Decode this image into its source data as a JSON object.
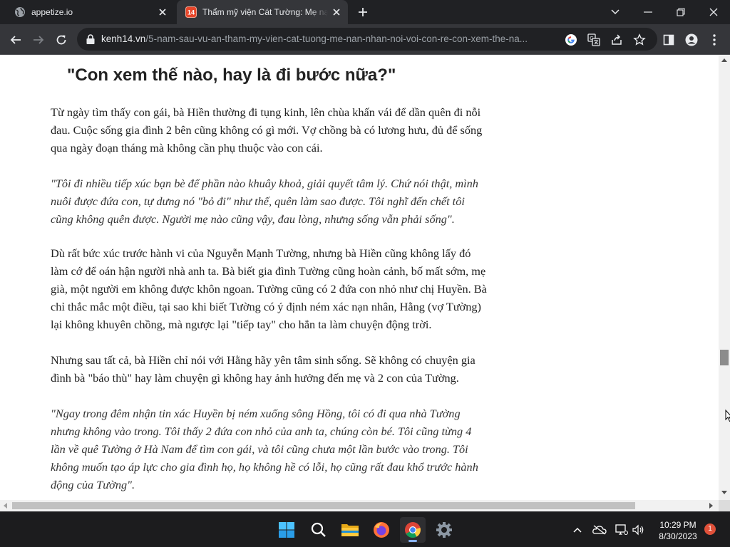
{
  "browser": {
    "tabs": [
      {
        "title": "appetize.io",
        "favicon": "globe-icon",
        "active": false
      },
      {
        "title": "Thẩm mỹ viện Cát Tường: Mẹ nạn nhân nói với con rể",
        "favicon": "kenh14-favicon",
        "favicon_text": "14",
        "active": true
      }
    ],
    "url_host": "kenh14.vn",
    "url_path": "/5-nam-sau-vu-an-tham-my-vien-cat-tuong-me-nan-nhan-noi-voi-con-re-con-xem-the-na...",
    "colors": {
      "frame": "#202124",
      "toolbar": "#35363a",
      "accent": "#8ab4f8"
    }
  },
  "article": {
    "heading": "\"Con xem thế nào, hay là đi bước nữa?\"",
    "paragraphs": [
      {
        "style": "normal",
        "lines": [
          "Từ ngày tìm thấy con gái, bà Hiền thường đi tụng kinh, lên chùa khấn vái để dần quên đi nỗi",
          "đau. Cuộc sống gia đình 2 bên cũng không có gì mới. Vợ chồng bà có lương hưu, đủ để sống",
          "qua ngày đoạn tháng mà không cần phụ thuộc vào con cái."
        ]
      },
      {
        "style": "quote",
        "lines": [
          "\"Tôi đi nhiều tiếp xúc bạn bè để phần nào khuây khoả, giải quyết tâm lý. Chứ nói thật, mình",
          "nuôi được đứa con, tự dưng nó \"bỏ đi\" như thế, quên làm sao được. Tôi nghĩ đến chết tôi",
          "cũng không quên được. Người mẹ nào cũng vậy, đau lòng, nhưng sống vẫn phải sống\"."
        ]
      },
      {
        "style": "normal",
        "lines": [
          "Dù rất bức xúc trước hành vi của Nguyễn Mạnh Tường, nhưng bà Hiền cũng không lấy đó",
          "làm cớ để oán hận người nhà anh ta. Bà biết gia đình Tường cũng hoàn cảnh, bố mất sớm, mẹ",
          "già, một người em không được khôn ngoan. Tường cũng có 2 đứa con nhỏ như chị Huyền. Bà",
          "chỉ thắc mắc một điều, tại sao khi biết Tường có ý định ném xác nạn nhân, Hằng (vợ Tường)",
          "lại không khuyên chồng, mà ngược lại \"tiếp tay\" cho hắn ta làm chuyện động trời."
        ]
      },
      {
        "style": "normal",
        "lines": [
          "Nhưng sau tất cả, bà Hiền chỉ nói với Hằng hãy yên tâm sinh sống. Sẽ không có chuyện gia",
          "đình bà \"báo thù\" hay làm chuyện gì không hay ảnh hưởng đến mẹ và 2 con của Tường."
        ]
      },
      {
        "style": "quote",
        "lines": [
          "\"Ngay trong đêm nhận tin xác Huyền bị ném xuống sông Hồng, tôi có đi qua nhà Tường",
          "nhưng không vào trong. Tôi thấy 2 đứa con nhỏ của anh ta, chúng còn bé. Tôi cũng từng 4",
          "lần về quê Tường ở Hà Nam để tìm con gái, và tôi cũng chưa một lần bước vào trong. Tôi",
          "không muốn tạo áp lực cho gia đình họ, họ không hề có lỗi, họ cũng rất đau khổ trước hành",
          "động của Tường\"."
        ]
      }
    ]
  },
  "taskbar": {
    "apps": [
      "start-icon",
      "search-icon",
      "file-explorer-icon",
      "firefox-icon",
      "chrome-icon",
      "settings-icon"
    ],
    "time": "10:29 PM",
    "date": "8/30/2023",
    "notification_count": "1"
  }
}
